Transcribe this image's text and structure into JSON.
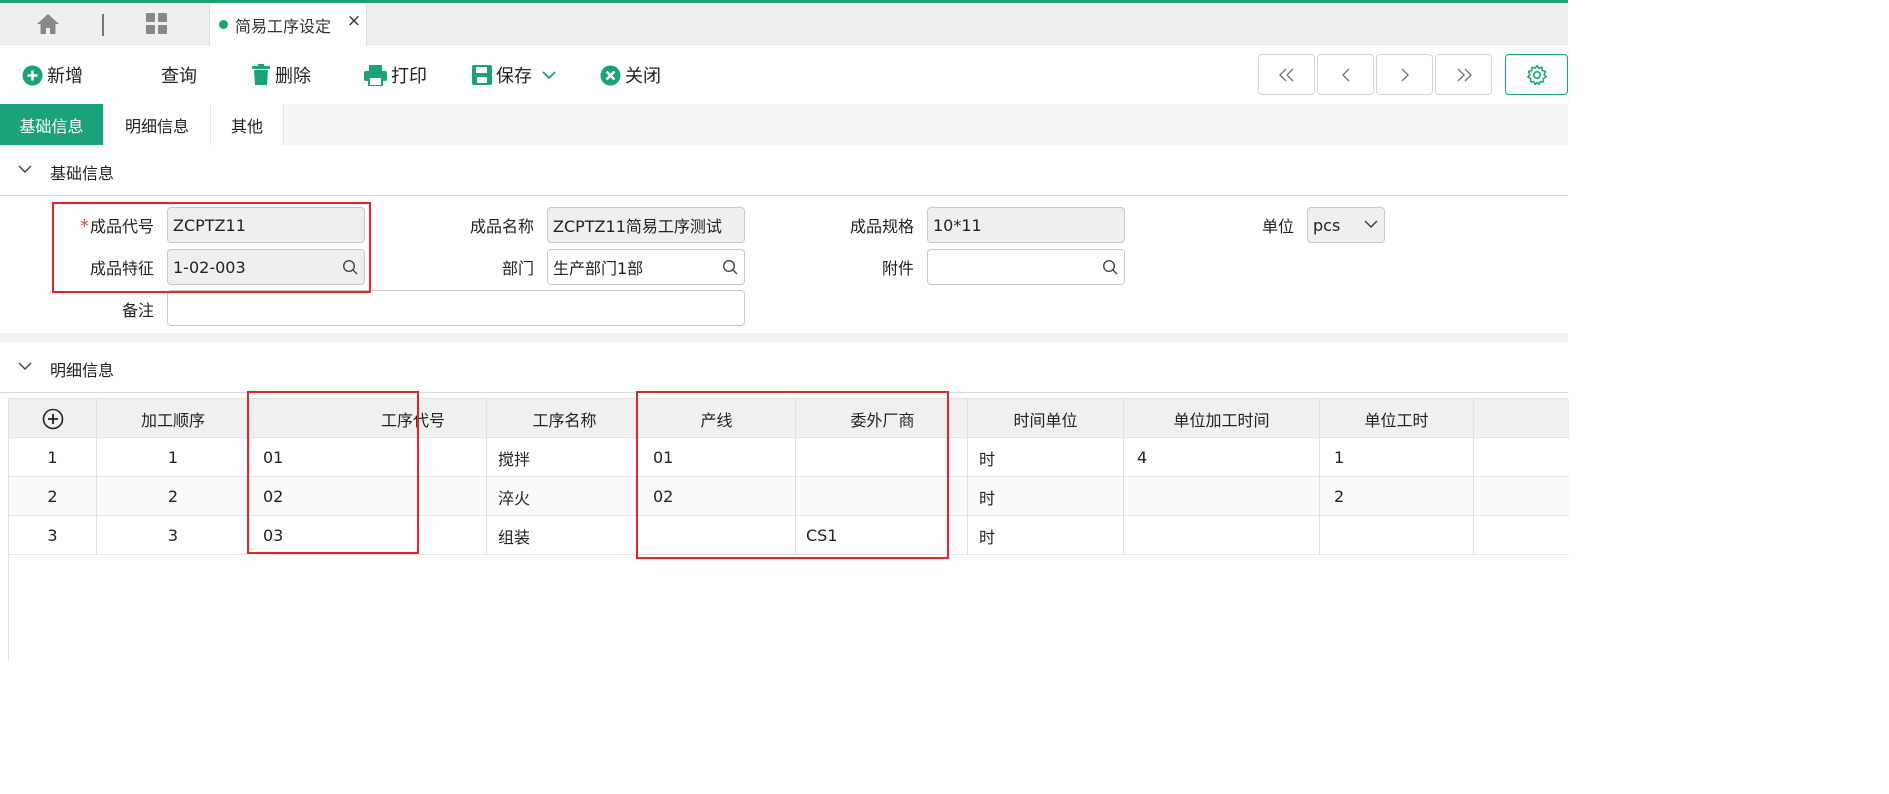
{
  "colors": {
    "accent": "#1aa37a",
    "highlight": "#e8232a",
    "required": "#e74c3c"
  },
  "tabbar": {
    "home_icon": "home-icon",
    "grid_icon": "grid-icon",
    "active_tab": {
      "label": "简易工序设定",
      "close": "×"
    }
  },
  "toolbar": {
    "add": "新增",
    "query": "查询",
    "delete": "删除",
    "print": "打印",
    "save": "保存",
    "close": "关闭",
    "nav_icons": [
      "first-icon",
      "prev-icon",
      "next-icon",
      "last-icon"
    ],
    "settings_icon": "gear-icon"
  },
  "section_tabs": [
    "基础信息",
    "明细信息",
    "其他"
  ],
  "basic": {
    "title": "基础信息",
    "fields": {
      "code": {
        "label": "成品代号",
        "required": "*",
        "value": "ZCPTZ11"
      },
      "name": {
        "label": "成品名称",
        "value": "ZCPTZ11简易工序测试"
      },
      "spec": {
        "label": "成品规格",
        "value": "10*11"
      },
      "unit": {
        "label": "单位",
        "value": "pcs"
      },
      "feature": {
        "label": "成品特征",
        "value": "1-02-003"
      },
      "dept": {
        "label": "部门",
        "value": "生产部门1部"
      },
      "attach": {
        "label": "附件",
        "value": ""
      },
      "remark": {
        "label": "备注",
        "value": ""
      }
    }
  },
  "detail": {
    "title": "明细信息",
    "columns": [
      "",
      "加工顺序",
      "工序代号",
      "工序名称",
      "产线",
      "委外厂商",
      "时间单位",
      "单位加工时间",
      "单位工时"
    ],
    "rows": [
      [
        "1",
        "1",
        "01",
        "搅拌",
        "01",
        "",
        "时",
        "4",
        "1"
      ],
      [
        "2",
        "2",
        "02",
        "淬火",
        "02",
        "",
        "时",
        "",
        "2"
      ],
      [
        "3",
        "3",
        "03",
        "组装",
        "",
        "CS1",
        "时",
        "",
        ""
      ]
    ]
  }
}
